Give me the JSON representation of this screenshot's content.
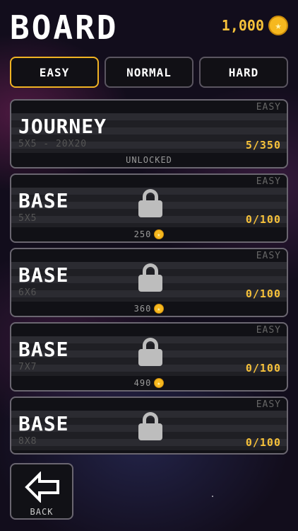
{
  "header": {
    "title": "BOARD",
    "coins": "1,000",
    "coin_icon": "coin-icon"
  },
  "tabs": [
    {
      "label": "EASY",
      "active": true
    },
    {
      "label": "NORMAL",
      "active": false
    },
    {
      "label": "HARD",
      "active": false
    }
  ],
  "cards": [
    {
      "difficulty": "EASY",
      "name": "JOURNEY",
      "size": "5X5 - 20X20",
      "progress": "5/350",
      "footer": "UNLOCKED",
      "locked": false
    },
    {
      "difficulty": "EASY",
      "name": "BASE",
      "size": "5X5",
      "progress": "0/100",
      "footer": "250",
      "locked": true
    },
    {
      "difficulty": "EASY",
      "name": "BASE",
      "size": "6X6",
      "progress": "0/100",
      "footer": "360",
      "locked": true
    },
    {
      "difficulty": "EASY",
      "name": "BASE",
      "size": "7X7",
      "progress": "0/100",
      "footer": "490",
      "locked": true
    },
    {
      "difficulty": "EASY",
      "name": "BASE",
      "size": "8X8",
      "progress": "0/100",
      "footer": "",
      "locked": true
    }
  ],
  "back": {
    "label": "BACK"
  },
  "colors": {
    "accent": "#f0b323",
    "coin": "#f6b81f",
    "progress": "#f7c23a"
  }
}
